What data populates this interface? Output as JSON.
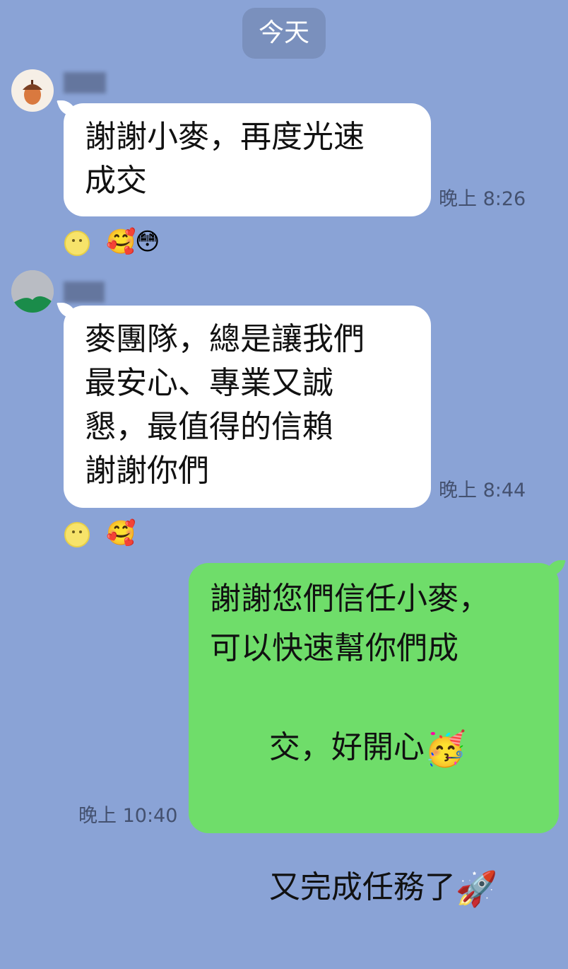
{
  "date_separator": "今天",
  "messages": [
    {
      "lines": [
        "謝謝小麥，再度光速",
        "成交"
      ],
      "time": "晚上 8:26",
      "reactions": [
        "😊",
        "🥰",
        "😳"
      ]
    },
    {
      "lines": [
        "麥團隊，總是讓我們",
        "最安心、專業又誠",
        "懇，最值得的信賴",
        "謝謝你們"
      ],
      "time": "晚上 8:44",
      "reactions": [
        "😊",
        "🥰"
      ]
    },
    {
      "lines": [
        "謝謝您們信任小麥，",
        "可以快速幫你們成",
        "交，好開心",
        "又完成任務了"
      ],
      "inline_emojis": [
        "🥳",
        "🚀"
      ],
      "time": "晚上 10:40"
    }
  ]
}
